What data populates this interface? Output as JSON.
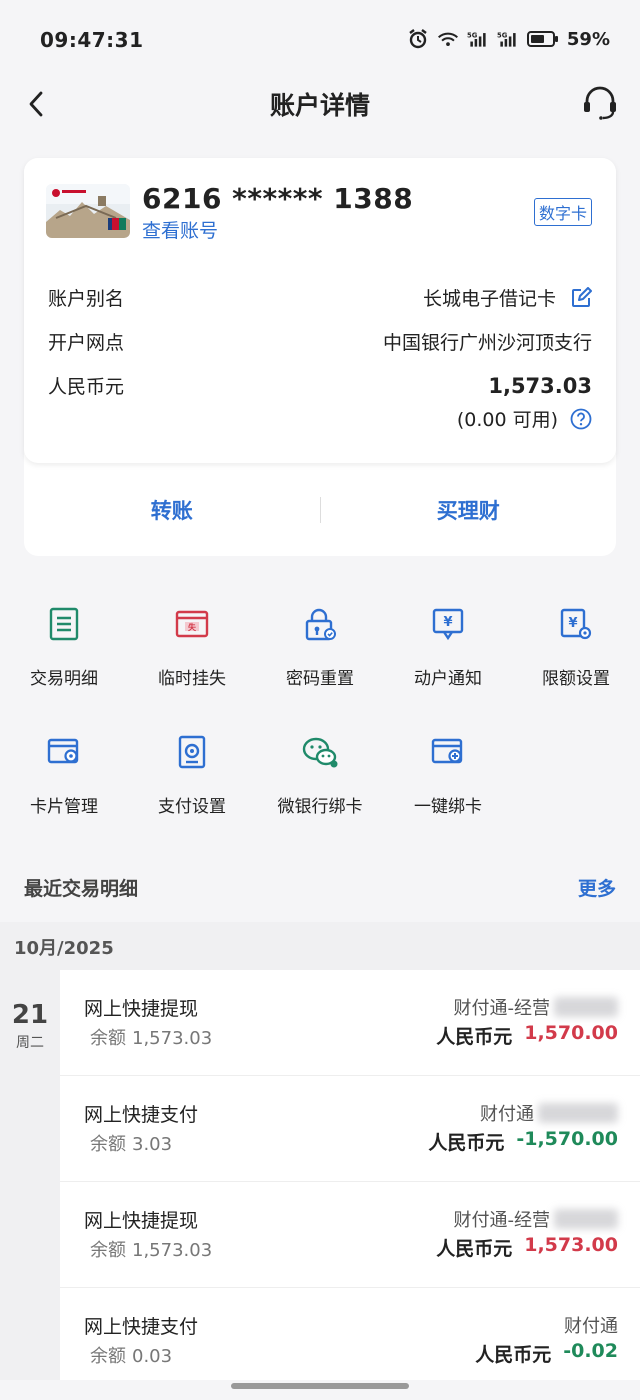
{
  "status": {
    "time": "09:47:31",
    "battery": "59%"
  },
  "header": {
    "title": "账户详情"
  },
  "card": {
    "number": "6216 ****** 1388",
    "view_account": "查看账号",
    "tag": "数字卡",
    "rows": [
      {
        "label": "账户别名",
        "value": "长城电子借记卡"
      },
      {
        "label": "开户网点",
        "value": "中国银行广州沙河顶支行"
      },
      {
        "label": "人民币元",
        "value": "1,573.03"
      }
    ],
    "available": "(0.00 可用)",
    "actions": [
      "转账",
      "买理财"
    ]
  },
  "services": [
    {
      "label": "交易明细",
      "icon": "list-icon",
      "color": "#1f8a6a"
    },
    {
      "label": "临时挂失",
      "icon": "lost-card-icon",
      "color": "#d23a4a"
    },
    {
      "label": "密码重置",
      "icon": "lock-icon",
      "color": "#2e6fd1"
    },
    {
      "label": "动户通知",
      "icon": "notify-icon",
      "color": "#2e6fd1"
    },
    {
      "label": "限额设置",
      "icon": "limit-icon",
      "color": "#2e6fd1"
    },
    {
      "label": "卡片管理",
      "icon": "card-gear-icon",
      "color": "#2e6fd1"
    },
    {
      "label": "支付设置",
      "icon": "pay-settings-icon",
      "color": "#2e6fd1"
    },
    {
      "label": "微银行绑卡",
      "icon": "wechat-icon",
      "color": "#1f8a6a"
    },
    {
      "label": "一键绑卡",
      "icon": "bind-card-icon",
      "color": "#2e6fd1"
    }
  ],
  "recent": {
    "title": "最近交易明细",
    "more": "更多",
    "month": "10月/2025",
    "day": "21",
    "weekday": "周二",
    "balance_label": "余额",
    "transactions": [
      {
        "name": "网上快捷提现",
        "balance": "1,573.03",
        "counterparty": "财付通-经营",
        "currency": "人民币元",
        "amount": "1,570.00",
        "direction": "in"
      },
      {
        "name": "网上快捷支付",
        "balance": "3.03",
        "counterparty": "财付通",
        "currency": "人民币元",
        "amount": "-1,570.00",
        "direction": "out"
      },
      {
        "name": "网上快捷提现",
        "balance": "1,573.03",
        "counterparty": "财付通-经营",
        "currency": "人民币元",
        "amount": "1,573.00",
        "direction": "in"
      },
      {
        "name": "网上快捷支付",
        "balance": "0.03",
        "counterparty": "财付通",
        "currency": "人民币元",
        "amount": "-0.02",
        "direction": "out"
      }
    ]
  }
}
